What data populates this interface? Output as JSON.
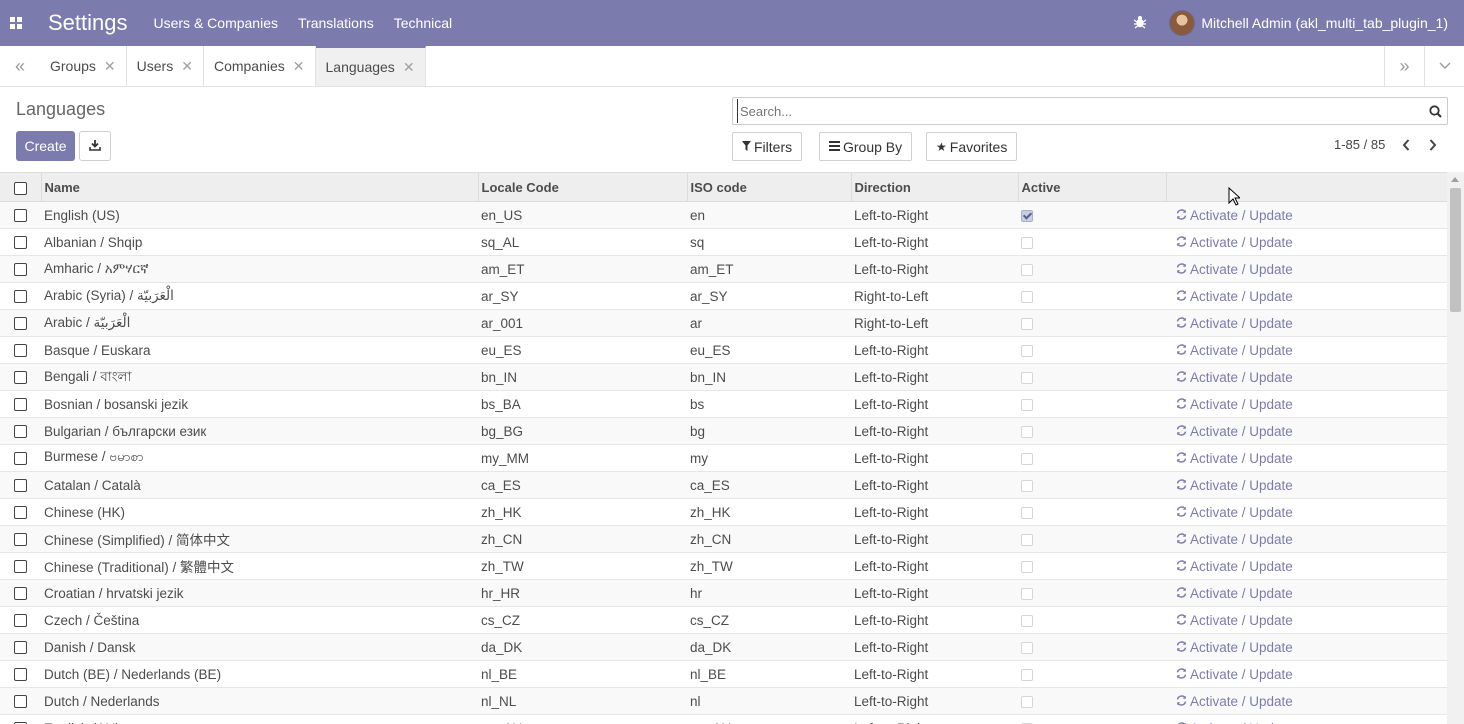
{
  "navbar": {
    "brand": "Settings",
    "menu": [
      "Users & Companies",
      "Translations",
      "Technical"
    ],
    "user": "Mitchell Admin (akl_multi_tab_plugin_1)"
  },
  "tabs": [
    {
      "label": "Groups",
      "active": false
    },
    {
      "label": "Users",
      "active": false
    },
    {
      "label": "Companies",
      "active": false
    },
    {
      "label": "Languages",
      "active": true
    }
  ],
  "control_panel": {
    "title": "Languages",
    "create_label": "Create",
    "search_placeholder": "Search...",
    "filters_label": "Filters",
    "groupby_label": "Group By",
    "favorites_label": "Favorites",
    "pager": "1-85 / 85"
  },
  "table": {
    "columns": [
      "Name",
      "Locale Code",
      "ISO code",
      "Direction",
      "Active"
    ],
    "action_label": "Activate / Update",
    "rows": [
      {
        "name": "English (US)",
        "locale": "en_US",
        "iso": "en",
        "direction": "Left-to-Right",
        "active": true
      },
      {
        "name": "Albanian / Shqip",
        "locale": "sq_AL",
        "iso": "sq",
        "direction": "Left-to-Right",
        "active": false
      },
      {
        "name": "Amharic / አምሃርኛ",
        "locale": "am_ET",
        "iso": "am_ET",
        "direction": "Left-to-Right",
        "active": false
      },
      {
        "name": "Arabic (Syria) / الْعَرَبيّة",
        "locale": "ar_SY",
        "iso": "ar_SY",
        "direction": "Right-to-Left",
        "active": false
      },
      {
        "name": "Arabic / الْعَرَبيّة",
        "locale": "ar_001",
        "iso": "ar",
        "direction": "Right-to-Left",
        "active": false
      },
      {
        "name": "Basque / Euskara",
        "locale": "eu_ES",
        "iso": "eu_ES",
        "direction": "Left-to-Right",
        "active": false
      },
      {
        "name": "Bengali / বাংলা",
        "locale": "bn_IN",
        "iso": "bn_IN",
        "direction": "Left-to-Right",
        "active": false
      },
      {
        "name": "Bosnian / bosanski jezik",
        "locale": "bs_BA",
        "iso": "bs",
        "direction": "Left-to-Right",
        "active": false
      },
      {
        "name": "Bulgarian / български език",
        "locale": "bg_BG",
        "iso": "bg",
        "direction": "Left-to-Right",
        "active": false
      },
      {
        "name": "Burmese / ဗမာစာ",
        "locale": "my_MM",
        "iso": "my",
        "direction": "Left-to-Right",
        "active": false
      },
      {
        "name": "Catalan / Català",
        "locale": "ca_ES",
        "iso": "ca_ES",
        "direction": "Left-to-Right",
        "active": false
      },
      {
        "name": "Chinese (HK)",
        "locale": "zh_HK",
        "iso": "zh_HK",
        "direction": "Left-to-Right",
        "active": false
      },
      {
        "name": "Chinese (Simplified) / 简体中文",
        "locale": "zh_CN",
        "iso": "zh_CN",
        "direction": "Left-to-Right",
        "active": false
      },
      {
        "name": "Chinese (Traditional) / 繁體中文",
        "locale": "zh_TW",
        "iso": "zh_TW",
        "direction": "Left-to-Right",
        "active": false
      },
      {
        "name": "Croatian / hrvatski jezik",
        "locale": "hr_HR",
        "iso": "hr",
        "direction": "Left-to-Right",
        "active": false
      },
      {
        "name": "Czech / Čeština",
        "locale": "cs_CZ",
        "iso": "cs_CZ",
        "direction": "Left-to-Right",
        "active": false
      },
      {
        "name": "Danish / Dansk",
        "locale": "da_DK",
        "iso": "da_DK",
        "direction": "Left-to-Right",
        "active": false
      },
      {
        "name": "Dutch (BE) / Nederlands (BE)",
        "locale": "nl_BE",
        "iso": "nl_BE",
        "direction": "Left-to-Right",
        "active": false
      },
      {
        "name": "Dutch / Nederlands",
        "locale": "nl_NL",
        "iso": "nl",
        "direction": "Left-to-Right",
        "active": false
      },
      {
        "name": "English (AU)",
        "locale": "en_AU",
        "iso": "en_AU",
        "direction": "Left-to-Right",
        "active": false
      }
    ]
  },
  "colors": {
    "primary": "#7c7bad",
    "text": "#4c4c4c",
    "header_bg": "#eeeeee"
  },
  "icons": {
    "apps": "apps-grid-icon",
    "debug": "bug-icon",
    "tab_close": "close-icon",
    "download": "download-icon",
    "search": "search-icon",
    "filter": "filter-icon",
    "groupby": "bars-icon",
    "favorites": "star-icon",
    "refresh": "refresh-icon"
  }
}
